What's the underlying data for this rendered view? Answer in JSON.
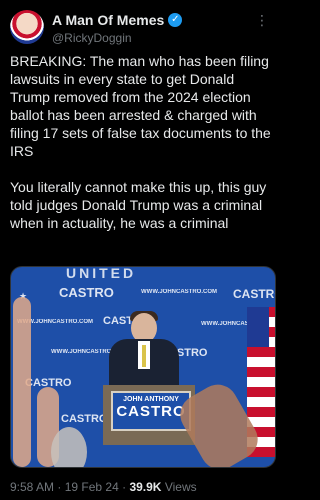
{
  "author": {
    "display_name": "A Man Of Memes",
    "handle": "@RickyDoggin",
    "verified": true,
    "verified_color": "#1d9bf0"
  },
  "tweet": {
    "text": "BREAKING: The man who has been filing lawsuits in every state to get Donald Trump removed from the 2024 election ballot has been arrested & charged with filing 17 sets of false tax documents to the IRS\n\nYou literally cannot make this up, this guy told judges Donald Trump was a criminal when in actuality, he was a criminal"
  },
  "media": {
    "banner_text": "UNITED",
    "backdrop_name": "CASTRO",
    "backdrop_url": "WWW.JOHNCASTRO.COM",
    "podium_small": "JOHN ANTHONY",
    "podium_name": "CASTRO",
    "backdrop_color": "#1e4fa8"
  },
  "meta": {
    "time": "9:58 AM",
    "date": "19 Feb 24",
    "views": "39.9K",
    "views_label": "Views"
  }
}
